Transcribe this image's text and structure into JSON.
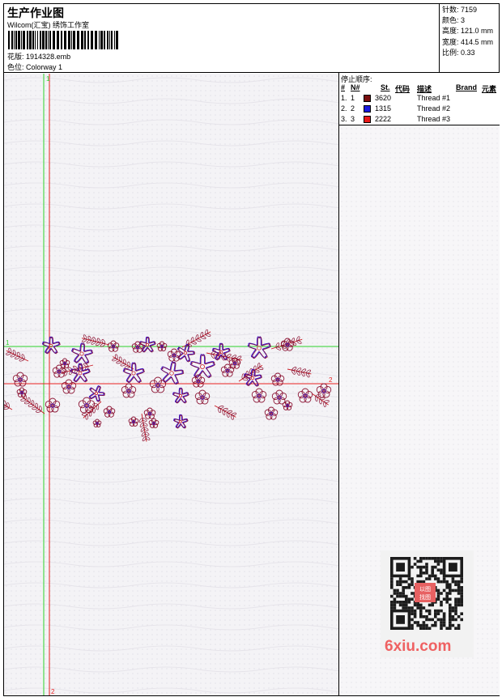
{
  "header": {
    "title": "生产作业图",
    "studio": "Wilcom(汇宝) 绣饰工作室",
    "design_label": "花版:",
    "design_value": "1914328.emb",
    "colorway_label": "色位:",
    "colorway_value": "Colorway 1"
  },
  "stats": [
    {
      "label": "针数:",
      "value": "7159"
    },
    {
      "label": "颜色:",
      "value": "3"
    },
    {
      "label": "高度:",
      "value": "121.0 mm"
    },
    {
      "label": "宽度:",
      "value": "414.5 mm"
    },
    {
      "label": "比例:",
      "value": "0.33"
    }
  ],
  "stop_sequence": {
    "title": "停止顺序:",
    "headers": [
      "#",
      "N#",
      "St.",
      "代码",
      "描述",
      "Brand",
      "元素"
    ],
    "rows": [
      {
        "num": "1.",
        "n": "1",
        "code": "3620",
        "desc": "Thread #1",
        "color": "#7a1010"
      },
      {
        "num": "2.",
        "n": "2",
        "code": "1315",
        "desc": "Thread #2",
        "color": "#1a1ae0"
      },
      {
        "num": "3.",
        "n": "3",
        "code": "2222",
        "desc": "Thread #3",
        "color": "#e81818"
      }
    ]
  },
  "guides": {
    "green_label_top": "1",
    "green_label_left": "1",
    "red_label_right": "2",
    "red_label_bottom": "2"
  },
  "watermark": "6xiu.com",
  "qr_stamp": "以图找图"
}
